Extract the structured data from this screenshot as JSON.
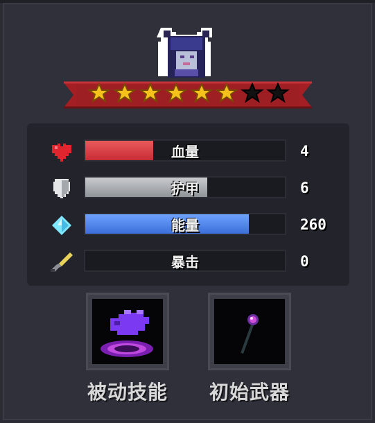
{
  "character": {
    "icon": "demon-girl-portrait",
    "stars_filled": 6,
    "stars_total": 8
  },
  "stats": [
    {
      "key": "health",
      "icon": "heart-icon",
      "label": "血量",
      "value": "4",
      "fill": 0.34,
      "color": "#d6343b"
    },
    {
      "key": "armor",
      "icon": "shield-icon",
      "label": "护甲",
      "value": "6",
      "fill": 0.61,
      "color": "#a9adb1"
    },
    {
      "key": "energy",
      "icon": "diamond-icon",
      "label": "能量",
      "value": "260",
      "fill": 0.82,
      "color": "#4d82ee"
    },
    {
      "key": "crit",
      "icon": "dagger-icon",
      "label": "暴击",
      "value": "0",
      "fill": 0,
      "color": "#000000"
    }
  ],
  "slots": {
    "passive_skill": {
      "label": "被动技能",
      "icon": "purple-hand-icon"
    },
    "starting_weapon": {
      "label": "初始武器",
      "icon": "staff-icon"
    }
  }
}
